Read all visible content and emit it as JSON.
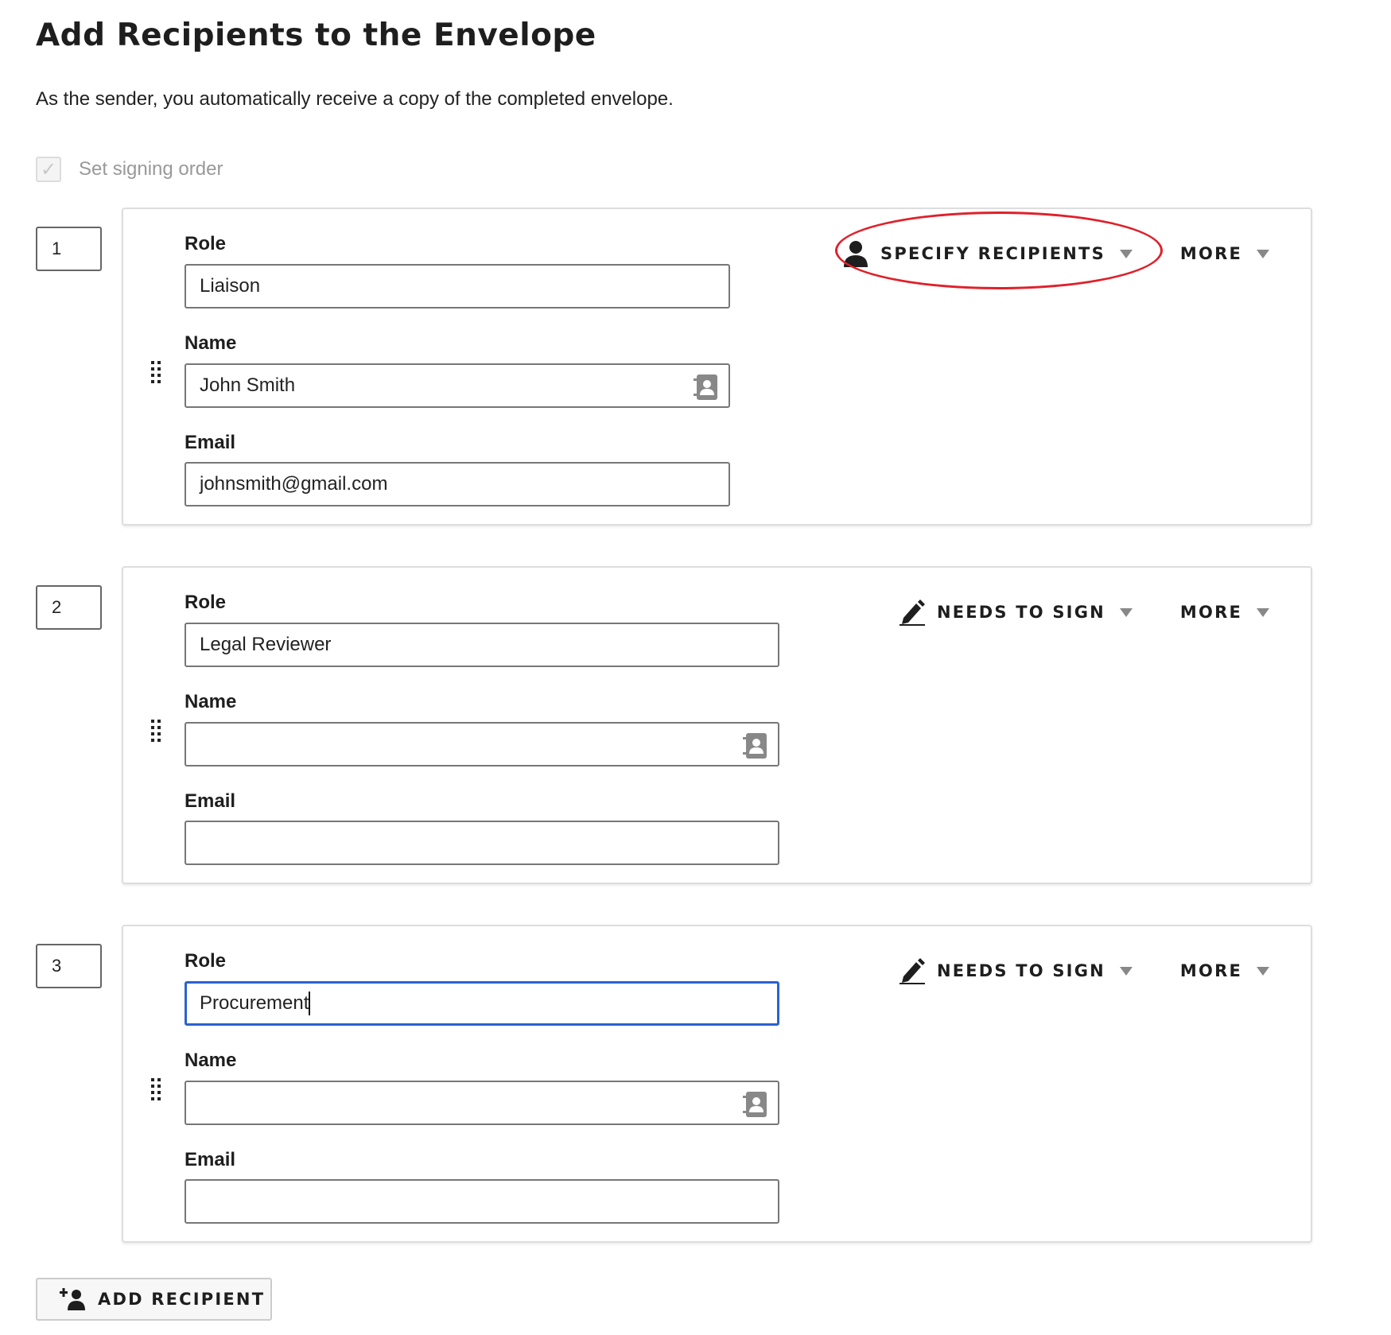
{
  "page": {
    "title": "Add Recipients to the Envelope",
    "subtitle": "As the sender, you automatically receive a copy of the completed envelope.",
    "signing_order": {
      "label": "Set signing order",
      "checked": true,
      "disabled": true
    }
  },
  "labels": {
    "role": "Role",
    "name": "Name",
    "email": "Email"
  },
  "recipients": [
    {
      "order": "1",
      "role": "Liaison",
      "name": "John Smith",
      "email": "johnsmith@gmail.com",
      "action": {
        "label": "SPECIFY RECIPIENTS",
        "icon": "person-icon"
      },
      "more_label": "MORE",
      "highlighted": true
    },
    {
      "order": "2",
      "role": "Legal Reviewer",
      "name": "",
      "email": "",
      "action": {
        "label": "NEEDS TO SIGN",
        "icon": "pen-icon"
      },
      "more_label": "MORE"
    },
    {
      "order": "3",
      "role": "Procurement",
      "name": "",
      "email": "",
      "action": {
        "label": "NEEDS TO SIGN",
        "icon": "pen-icon"
      },
      "more_label": "MORE",
      "focused_field": "role"
    }
  ],
  "add_recipient": {
    "label": "ADD RECIPIENT",
    "icon": "add-person-icon"
  },
  "colors": {
    "focus": "#2a62cf",
    "annotation": "#e0202a",
    "caret": "#888888"
  }
}
